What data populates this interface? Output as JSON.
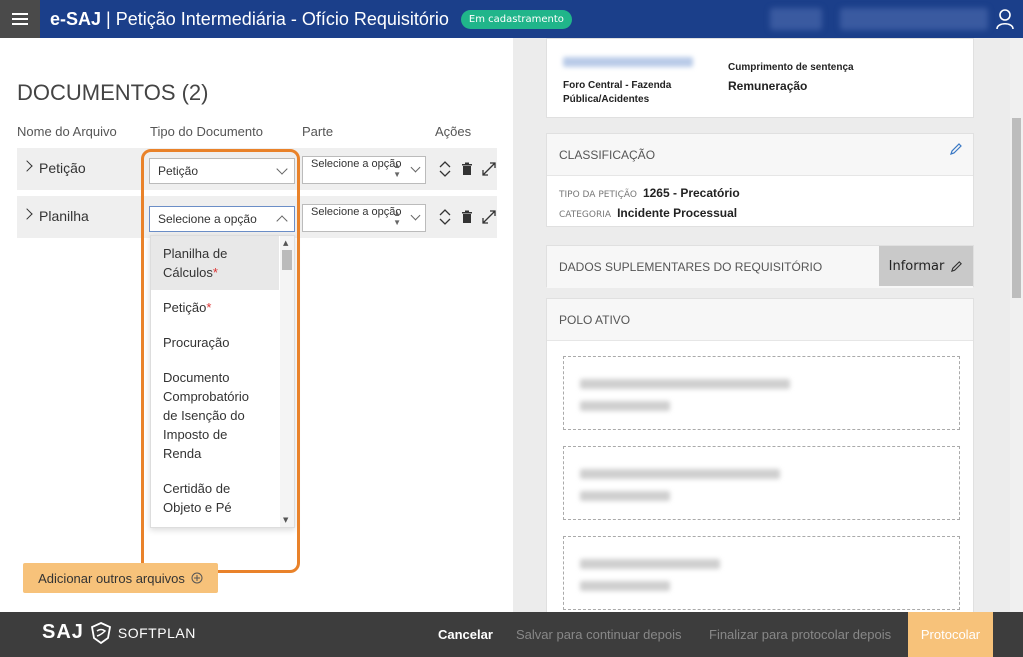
{
  "header": {
    "app_name": "e-SAJ",
    "separator": "|",
    "page_title": "Petição Intermediária - Ofício Requisitório",
    "status_badge": "Em cadastramento"
  },
  "documents": {
    "title": "DOCUMENTOS (2)",
    "columns": {
      "file_name": "Nome do Arquivo",
      "doc_type": "Tipo do Documento",
      "party": "Parte",
      "actions": "Ações"
    },
    "rows": [
      {
        "name": "Petição",
        "doc_type_value": "Petição",
        "party_value": "Selecione a opção"
      },
      {
        "name": "Planilha",
        "doc_type_value": "Selecione a opção",
        "party_value": "Selecione a opção"
      }
    ],
    "dropdown_options": [
      {
        "label": "Planilha de Cálculos",
        "required": "*"
      },
      {
        "label": "Petição",
        "required": "*"
      },
      {
        "label": "Procuração",
        "required": ""
      },
      {
        "label": "Documento Comprobatório de Isenção do Imposto de Renda",
        "required": ""
      },
      {
        "label": "Certidão de Objeto e Pé",
        "required": ""
      }
    ],
    "add_button": "Adicionar outros arquivos"
  },
  "right_panel": {
    "process_info": {
      "forum": "Foro Central - Fazenda Pública/Acidentes",
      "class_label": "Cumprimento de sentença",
      "subject": "Remuneração"
    },
    "classification": {
      "header": "CLASSIFICAÇÃO",
      "petition_type_label": "TIPO DA PETIÇÃO",
      "petition_type_value": "1265 - Precatório",
      "category_label": "CATEGORIA",
      "category_value": "Incidente Processual"
    },
    "supplementary": {
      "header": "DADOS SUPLEMENTARES DO REQUISITÓRIO",
      "inform_button": "Informar"
    },
    "polo_ativo": {
      "header": "POLO ATIVO"
    }
  },
  "footer": {
    "logo_saj": "SAJ",
    "logo_softplan": "SOFTPLAN",
    "cancel": "Cancelar",
    "save_later": "Salvar para continuar depois",
    "finalize_later": "Finalizar para protocolar depois",
    "protocol": "Protocolar"
  },
  "colors": {
    "header_bg": "#1b3f8a",
    "badge": "#20b58a",
    "highlight": "#e9822a",
    "accent_button": "#f7c27a",
    "footer_bg": "#3d3d3d"
  }
}
